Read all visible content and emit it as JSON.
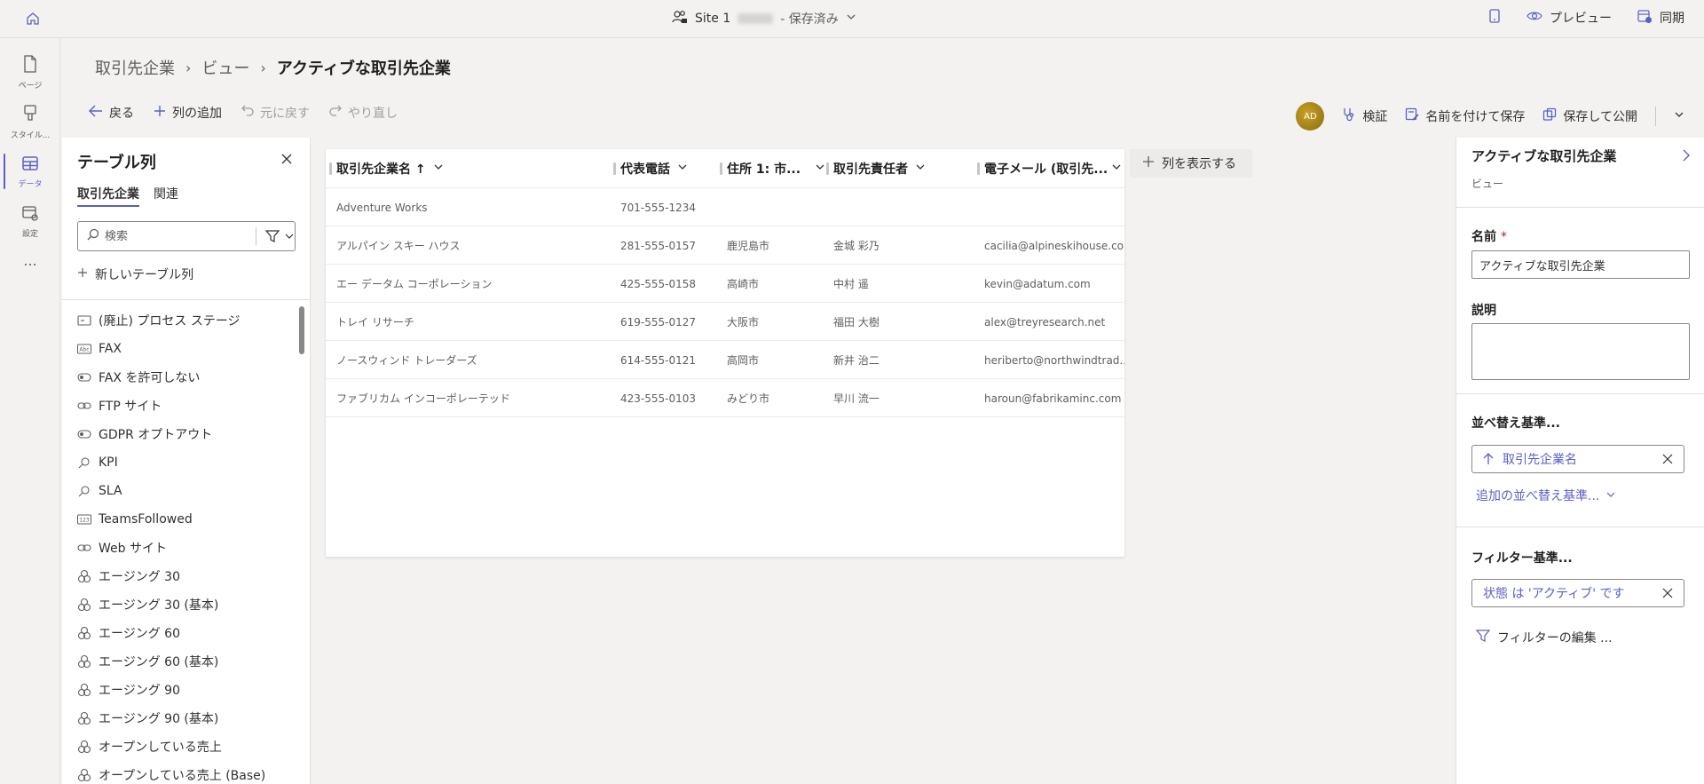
{
  "topbar": {
    "site_name": "Site 1",
    "status": "- 保存済み",
    "preview_label": "プレビュー",
    "sync_label": "同期"
  },
  "rail": {
    "items": [
      {
        "label": "ページ",
        "icon": "page-icon"
      },
      {
        "label": "スタイル...",
        "icon": "brush-icon"
      },
      {
        "label": "データ",
        "icon": "table-icon"
      },
      {
        "label": "設定",
        "icon": "settings-icon"
      },
      {
        "label": "...",
        "icon": "more-icon"
      }
    ]
  },
  "breadcrumb": {
    "items": [
      "取引先企業",
      "ビュー"
    ],
    "current": "アクティブな取引先企業"
  },
  "toolbar": {
    "back_label": "戻る",
    "add_column_label": "列の追加",
    "undo_label": "元に戻す",
    "redo_label": "やり直し",
    "avatar_initials": "AD",
    "validate_label": "検証",
    "save_as_label": "名前を付けて保存",
    "save_publish_label": "保存して公開"
  },
  "left_panel": {
    "title": "テーブル列",
    "tabs": [
      "取引先企業",
      "関連"
    ],
    "search_placeholder": "検索",
    "new_column_label": "新しいテーブル列",
    "fields": [
      {
        "label": "(廃止) プロセス ステージ",
        "icon": "text-field-icon"
      },
      {
        "label": "FAX",
        "icon": "abc-icon"
      },
      {
        "label": "FAX を許可しない",
        "icon": "toggle-icon"
      },
      {
        "label": "FTP サイト",
        "icon": "link-icon"
      },
      {
        "label": "GDPR オプトアウト",
        "icon": "toggle-icon"
      },
      {
        "label": "KPI",
        "icon": "lookup-icon"
      },
      {
        "label": "SLA",
        "icon": "lookup-icon"
      },
      {
        "label": "TeamsFollowed",
        "icon": "number-icon"
      },
      {
        "label": "Web サイト",
        "icon": "link-icon"
      },
      {
        "label": "エージング 30",
        "icon": "currency-icon"
      },
      {
        "label": "エージング 30 (基本)",
        "icon": "currency-icon"
      },
      {
        "label": "エージング 60",
        "icon": "currency-icon"
      },
      {
        "label": "エージング 60 (基本)",
        "icon": "currency-icon"
      },
      {
        "label": "エージング 90",
        "icon": "currency-icon"
      },
      {
        "label": "エージング 90 (基本)",
        "icon": "currency-icon"
      },
      {
        "label": "オープンしている売上",
        "icon": "currency-icon"
      },
      {
        "label": "オープンしている売上 (Base)",
        "icon": "currency-icon"
      }
    ]
  },
  "grid": {
    "columns": [
      "取引先企業名 ↑",
      "代表電話",
      "住所 1: 市...",
      "取引先責任者",
      "電子メール (取引先..."
    ],
    "rows": [
      [
        "Adventure Works",
        "701-555-1234",
        "",
        "",
        ""
      ],
      [
        "アルパイン スキー ハウス",
        "281-555-0157",
        "鹿児島市",
        "金城 彩乃",
        "cacilia@alpineskihouse.com"
      ],
      [
        "エー データム コーポレーション",
        "425-555-0158",
        "高崎市",
        "中村 遥",
        "kevin@adatum.com"
      ],
      [
        "トレイ リサーチ",
        "619-555-0127",
        "大阪市",
        "福田 大樹",
        "alex@treyresearch.net"
      ],
      [
        "ノースウィンド トレーダーズ",
        "614-555-0121",
        "高岡市",
        "新井 治二",
        "heriberto@northwindtrad..."
      ],
      [
        "ファブリカム インコーポレーテッド",
        "423-555-0103",
        "みどり市",
        "早川 流一",
        "haroun@fabrikaminc.com"
      ]
    ],
    "show_columns_label": "列を表示する"
  },
  "right_panel": {
    "title": "アクティブな取引先企業",
    "subtitle": "ビュー",
    "name_label": "名前",
    "name_value": "アクティブな取引先企業",
    "description_label": "説明",
    "description_value": "",
    "sort_label": "並べ替え基準...",
    "sort_pill": "取引先企業名",
    "add_sort_label": "追加の並べ替え基準...",
    "filter_label": "フィルター基準...",
    "filter_pill": "状態 は 'アクティブ' です",
    "edit_filter_label": "フィルターの編集 ..."
  },
  "colors": {
    "accent": "#5b5fc7",
    "text": "#323130",
    "muted": "#605e5c",
    "background": "#f3f2f1"
  }
}
